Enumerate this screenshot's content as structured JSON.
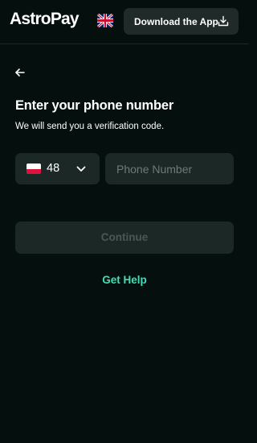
{
  "header": {
    "logo_text": "AstroPay",
    "language_flag": "uk-flag-icon",
    "download_label": "Download the App",
    "download_icon": "download-icon"
  },
  "main": {
    "back_icon": "arrow-left-icon",
    "title": "Enter your phone number",
    "subtitle": "We will send you a verification code.",
    "country": {
      "flag": "poland-flag-icon",
      "code": "48",
      "chevron_icon": "chevron-down-icon"
    },
    "phone": {
      "value": "",
      "placeholder": "Phone Number"
    },
    "continue_label": "Continue",
    "help_label": "Get Help"
  },
  "colors": {
    "background": "#040f0e",
    "surface": "#1c2826",
    "accent": "#3ee0b5",
    "disabled_text": "#4a5755",
    "placeholder": "#6e7a78"
  }
}
